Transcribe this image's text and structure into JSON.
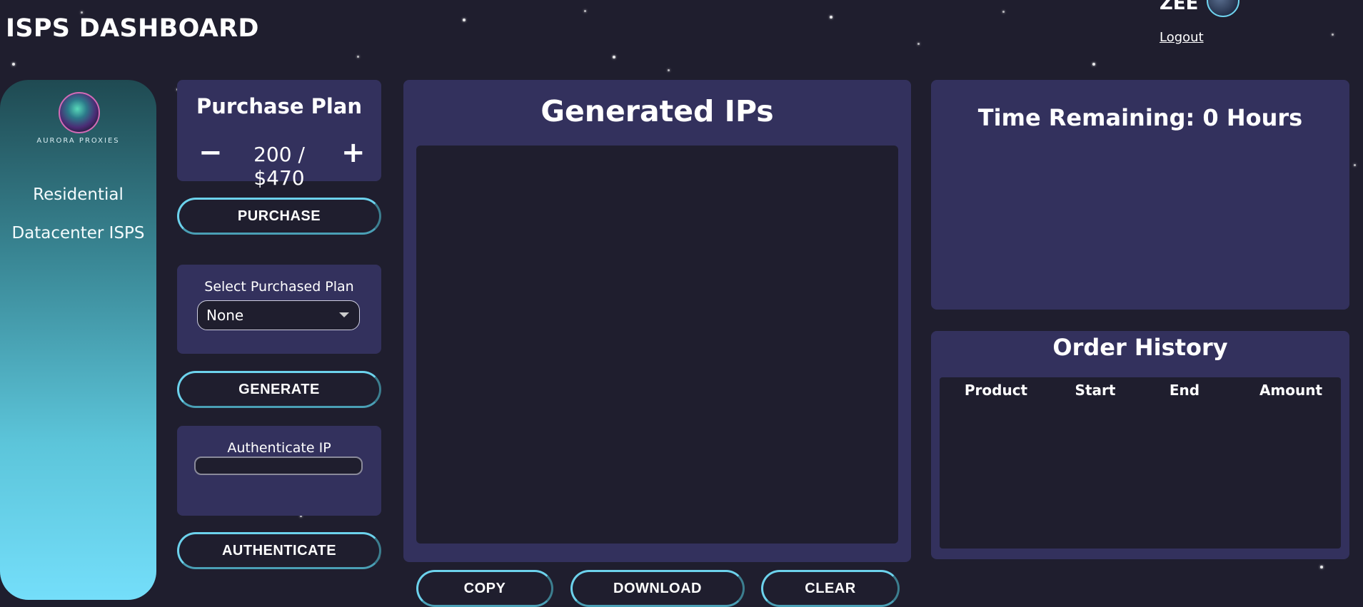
{
  "header": {
    "title": "ISPS DASHBOARD"
  },
  "user": {
    "name": "ZEE",
    "logout_label": "Logout"
  },
  "sidebar": {
    "logo_text": "AURORA PROXIES",
    "items": [
      {
        "label": "Residential"
      },
      {
        "label": "Datacenter ISPS"
      }
    ]
  },
  "purchase_plan": {
    "title": "Purchase Plan",
    "minus_icon": "−",
    "plus_icon": "+",
    "value": "200 / $470",
    "purchase_label": "PURCHASE"
  },
  "select_plan": {
    "label": "Select Purchased Plan",
    "selected": "None",
    "generate_label": "GENERATE"
  },
  "authenticate": {
    "label": "Authenticate IP",
    "input_value": "",
    "button_label": "AUTHENTICATE"
  },
  "generated": {
    "title": "Generated IPs",
    "copy_label": "COPY",
    "download_label": "DOWNLOAD",
    "clear_label": "CLEAR"
  },
  "time_remaining": {
    "title": "Time Remaining: 0 Hours"
  },
  "order_history": {
    "title": "Order History",
    "columns": [
      "Product",
      "Start",
      "End",
      "Amount"
    ]
  },
  "colors": {
    "background": "#1f1e2e",
    "panel": "#33315d",
    "accent": "#6cd2ec"
  }
}
